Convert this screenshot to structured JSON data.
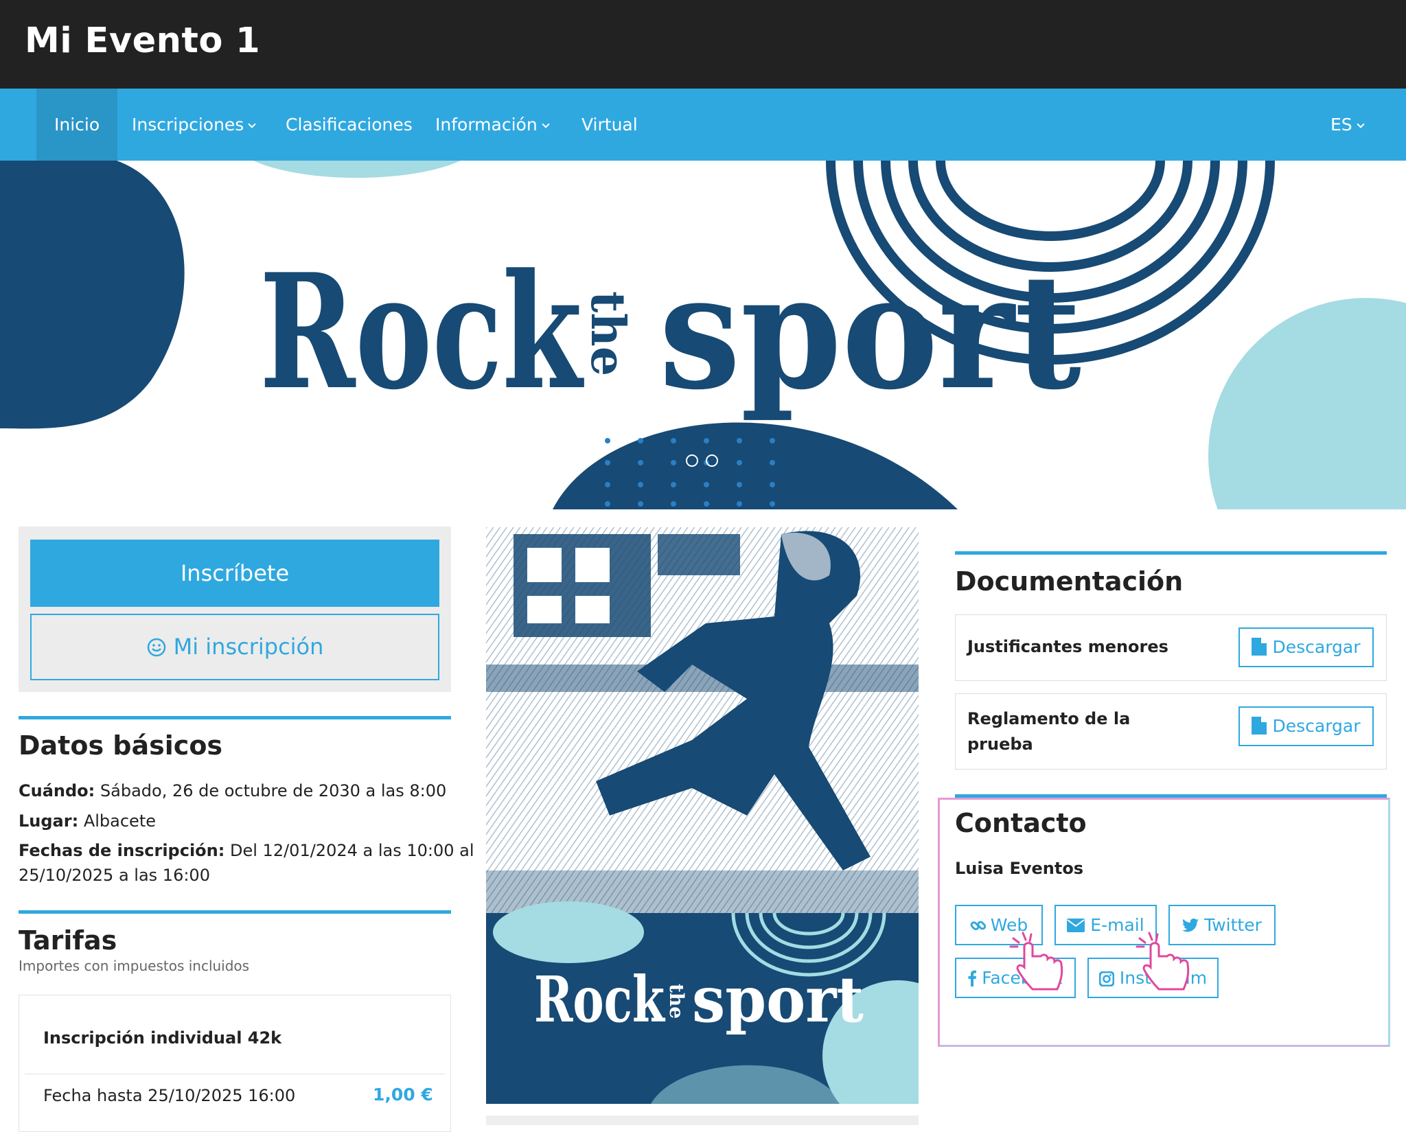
{
  "header": {
    "title": "Mi Evento 1"
  },
  "nav": {
    "items": [
      {
        "label": "Inicio"
      },
      {
        "label": "Inscripciones"
      },
      {
        "label": "Clasificaciones"
      },
      {
        "label": "Información"
      },
      {
        "label": "Virtual"
      }
    ],
    "language": "ES"
  },
  "hero": {
    "logo_text_left": "Rock",
    "logo_text_middle": "the",
    "logo_text_right": "sport",
    "carousel_slides": 2,
    "colors": {
      "navy": "#174a74",
      "light_blue": "#a5dbe3",
      "dots": "#2a7fc5"
    }
  },
  "actions": {
    "inscribete": "Inscríbete",
    "mi_inscripcion": "Mi inscripción",
    "mi_inscripcion_icon": "smile-icon"
  },
  "datos": {
    "title": "Datos básicos",
    "cuando_label": "Cuándo:",
    "cuando_value": "Sábado, 26 de octubre de 2030 a las 8:00",
    "lugar_label": "Lugar:",
    "lugar_value": "Albacete",
    "fechas_label": "Fechas de inscripción:",
    "fechas_value_1": "Del 12/01/2024 a las 10:00 al",
    "fechas_value_2": "25/10/2025 a las 16:00"
  },
  "tarifas": {
    "title": "Tarifas",
    "subtitle": "Importes con impuestos incluidos",
    "item_name": "Inscripción individual 42k",
    "item_deadline": "Fecha hasta 25/10/2025 16:00",
    "item_price": "1,00 €"
  },
  "poster": {
    "logo_text_left": "Rock",
    "logo_text_middle": "the",
    "logo_text_right": "sport"
  },
  "documentacion": {
    "title": "Documentación",
    "docs": [
      {
        "label_1": "Justificantes menores",
        "label_2": "",
        "button": "Descargar"
      },
      {
        "label_1": "Reglamento de la",
        "label_2": "prueba",
        "button": "Descargar"
      }
    ]
  },
  "contacto": {
    "title": "Contacto",
    "name": "Luisa Eventos",
    "links": [
      {
        "label": "Web",
        "icon": "link-icon"
      },
      {
        "label": "E-mail",
        "icon": "envelope-icon"
      },
      {
        "label": "Twitter",
        "icon": "twitter-icon"
      },
      {
        "label": "Facebook",
        "icon": "facebook-icon"
      },
      {
        "label": "Instagram",
        "icon": "instagram-icon"
      }
    ]
  },
  "colors": {
    "accent": "#2fa8e0",
    "header_bg": "#222222",
    "highlight": "#e79ad3"
  }
}
